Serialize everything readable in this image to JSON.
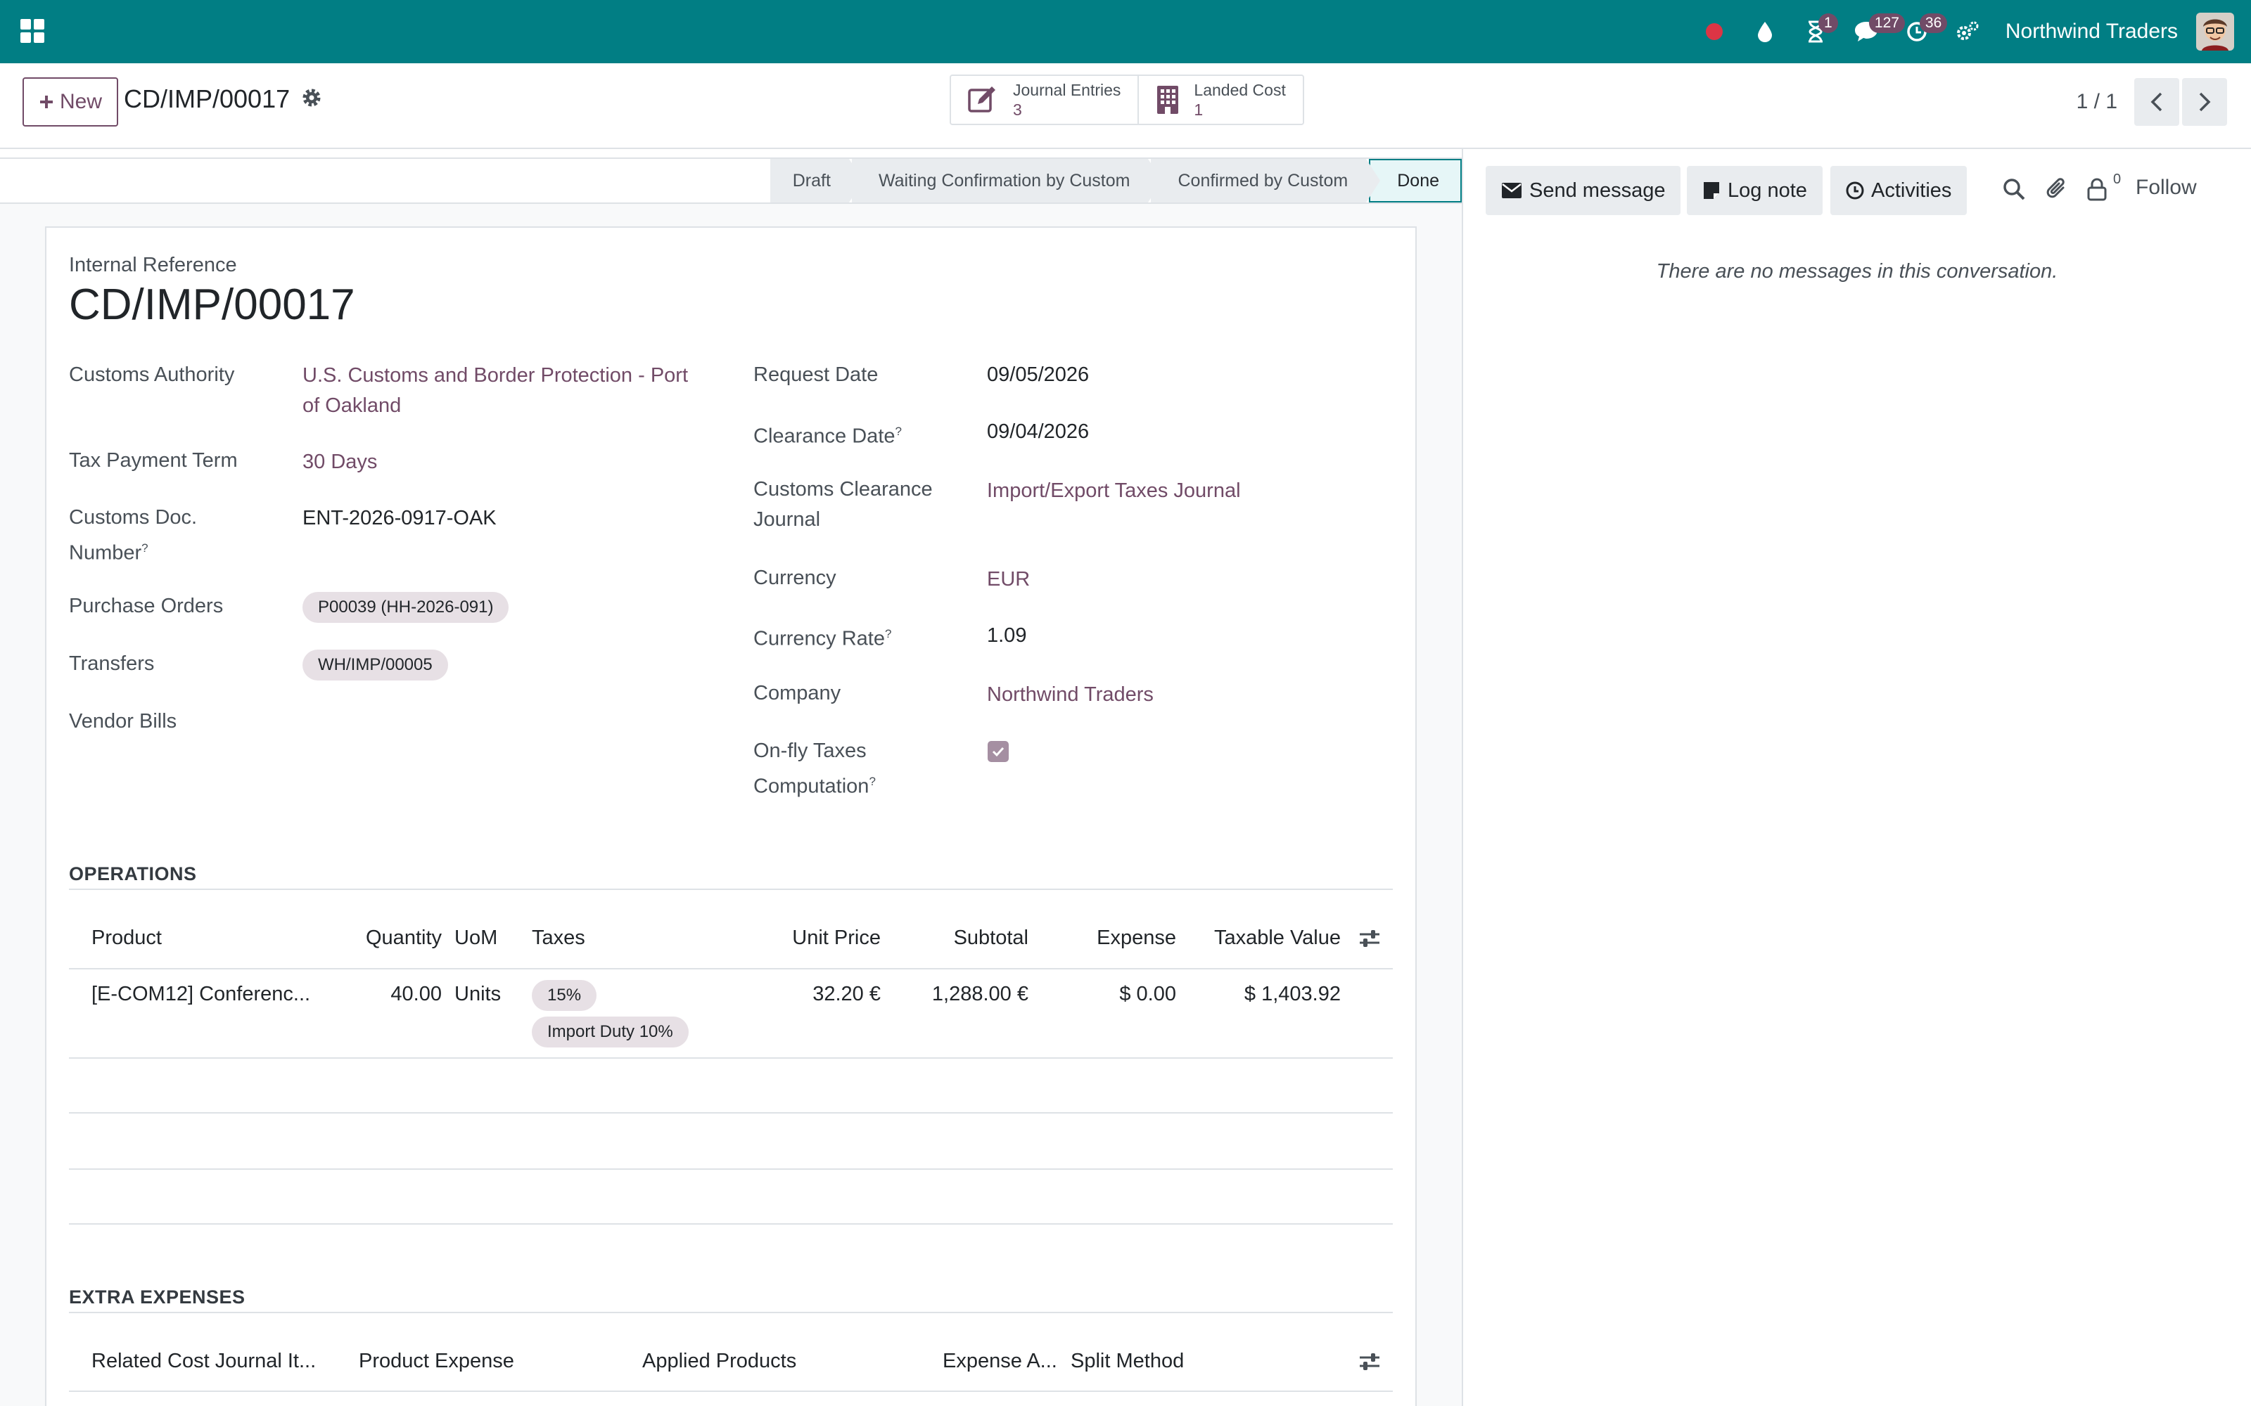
{
  "navbar": {
    "company": "Northwind Traders",
    "activity_badge": "1",
    "messages_badge": "127",
    "timer_badge": "36",
    "icons": [
      "apps-icon",
      "record-dot-icon",
      "droplet-icon",
      "hourglass-icon",
      "chat-icon",
      "timer-icon",
      "settings-icon",
      "avatar"
    ]
  },
  "control": {
    "new_label": "New",
    "record_title": "CD/IMP/00017",
    "smart_buttons": [
      {
        "label": "Journal Entries",
        "count": "3"
      },
      {
        "label": "Landed Cost",
        "count": "1"
      }
    ],
    "pager": "1 / 1"
  },
  "status": {
    "stages": [
      "Draft",
      "Waiting Confirmation by Custom",
      "Confirmed by Custom",
      "Done"
    ],
    "current": "Done"
  },
  "form": {
    "internal_ref_label": "Internal Reference",
    "internal_ref": "CD/IMP/00017",
    "left": {
      "customs_authority_label": "Customs Authority",
      "customs_authority_line1": "U.S. Customs and Border Protection - Port",
      "customs_authority_line2": "of Oakland",
      "tax_payment_term_label": "Tax Payment Term",
      "tax_payment_term": "30 Days",
      "customs_doc_label_line1": "Customs Doc.",
      "customs_doc_label_line2": "Number",
      "customs_doc": "ENT-2026-0917-OAK",
      "purchase_orders_label": "Purchase Orders",
      "purchase_order_tag": "P00039 (HH-2026-091)",
      "transfers_label": "Transfers",
      "transfer_tag": "WH/IMP/00005",
      "vendor_bills_label": "Vendor Bills"
    },
    "right": {
      "request_date_label": "Request Date",
      "request_date": "09/05/2026",
      "clearance_date_label": "Clearance Date",
      "clearance_date": "09/04/2026",
      "journal_label_line1": "Customs Clearance",
      "journal_label_line2": "Journal",
      "journal": "Import/Export Taxes Journal",
      "currency_label": "Currency",
      "currency": "EUR",
      "currency_rate_label": "Currency Rate",
      "currency_rate": "1.09",
      "company_label": "Company",
      "company": "Northwind Traders",
      "onfly_label_line1": "On-fly Taxes",
      "onfly_label_line2": "Computation",
      "onfly_checked": true
    },
    "help_mark": "?"
  },
  "operations": {
    "title": "OPERATIONS",
    "headers": [
      "Product",
      "Quantity",
      "UoM",
      "Taxes",
      "Unit Price",
      "Subtotal",
      "Expense",
      "Taxable Value"
    ],
    "rows": [
      {
        "product": "[E-COM12] Conferenc...",
        "quantity": "40.00",
        "uom": "Units",
        "taxes": [
          "15%",
          "Import Duty 10%"
        ],
        "unit_price": "32.20 €",
        "subtotal": "1,288.00 €",
        "expense": "$ 0.00",
        "taxable_value": "$ 1,403.92"
      }
    ]
  },
  "extra_expenses": {
    "title": "EXTRA EXPENSES",
    "headers": [
      "Related Cost Journal It...",
      "Product Expense",
      "Applied Products",
      "Expense A...",
      "Split Method"
    ]
  },
  "chatter": {
    "send_message": "Send message",
    "log_note": "Log note",
    "activities": "Activities",
    "followers_count": "0",
    "follow": "Follow",
    "empty_text": "There are no messages in this conversation."
  },
  "colors": {
    "navbar": "#017e84",
    "brand": "#714b67",
    "tag_bg": "#e7e0e5"
  }
}
